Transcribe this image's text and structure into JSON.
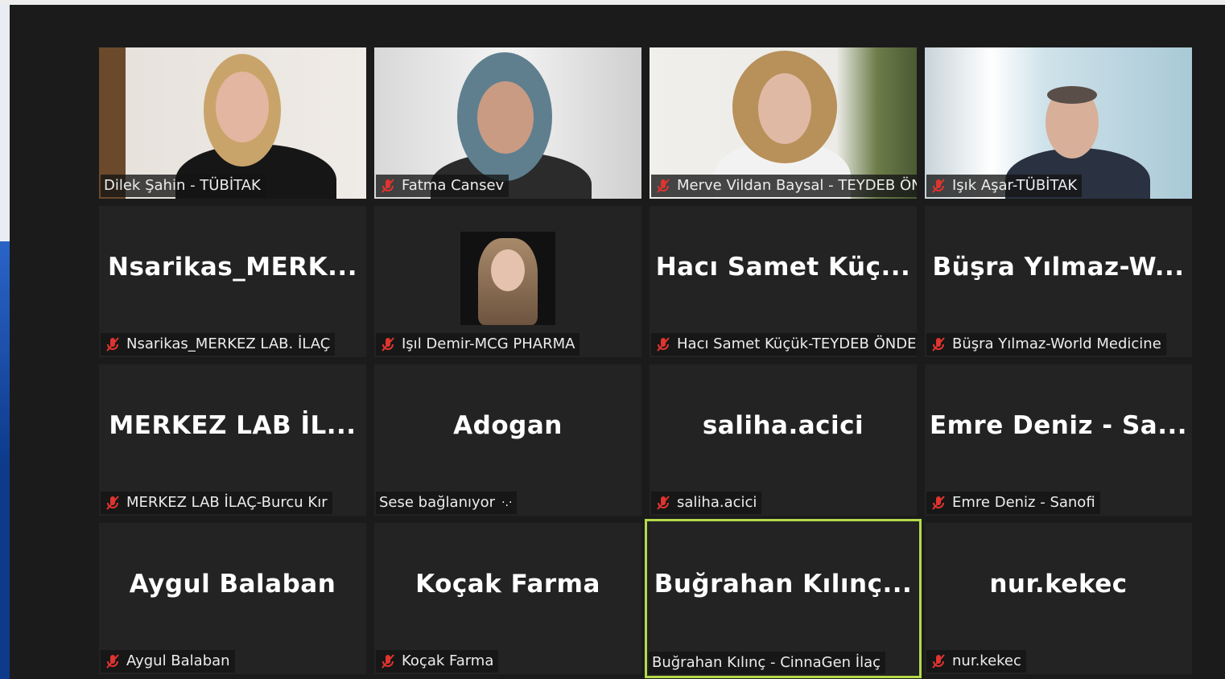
{
  "participants": [
    {
      "display_name": "",
      "label": "Dilek Şahin - TÜBİTAK",
      "muted": false,
      "video": true
    },
    {
      "display_name": "",
      "label": "Fatma Cansev",
      "muted": true,
      "video": true
    },
    {
      "display_name": "",
      "label": "Merve Vildan Baysal - TEYDEB ÖN...",
      "muted": true,
      "video": true
    },
    {
      "display_name": "",
      "label": "Işık Aşar-TÜBİTAK",
      "muted": true,
      "video": true
    },
    {
      "display_name": "Nsarikas_MERK...",
      "label": "Nsarikas_MERKEZ LAB. İLAÇ",
      "muted": true,
      "video": false
    },
    {
      "display_name": "",
      "label": "Işıl Demir-MCG PHARMA",
      "muted": true,
      "video": false
    },
    {
      "display_name": "Hacı Samet Küç...",
      "label": "Hacı Samet Küçük-TEYDEB ÖNDEG",
      "muted": true,
      "video": false
    },
    {
      "display_name": "Büşra Yılmaz-W...",
      "label": "Büşra Yılmaz-World Medicine",
      "muted": true,
      "video": false
    },
    {
      "display_name": "MERKEZ LAB İL...",
      "label": "MERKEZ LAB İLAÇ-Burcu Kır",
      "muted": true,
      "video": false
    },
    {
      "display_name": "Adogan",
      "label": "Sese bağlanıyor",
      "muted": false,
      "video": false
    },
    {
      "display_name": "saliha.acici",
      "label": "saliha.acici",
      "muted": true,
      "video": false
    },
    {
      "display_name": "Emre Deniz - Sa...",
      "label": "Emre Deniz - Sanofi",
      "muted": true,
      "video": false
    },
    {
      "display_name": "Aygul Balaban",
      "label": "Aygul Balaban",
      "muted": true,
      "video": false
    },
    {
      "display_name": "Koçak Farma",
      "label": "Koçak Farma",
      "muted": true,
      "video": false
    },
    {
      "display_name": "Buğrahan Kılınç...",
      "label": "Buğrahan Kılınç - CinnaGen İlaç",
      "muted": false,
      "video": false,
      "active_speaker": true
    },
    {
      "display_name": "nur.kekec",
      "label": "nur.kekec",
      "muted": true,
      "video": false
    }
  ],
  "connecting_indicator": "·.·",
  "colors": {
    "tile_background": "#232323",
    "window_background": "#1b1b1b",
    "active_speaker_border": "#b5d94a",
    "muted_icon": "#e0342f"
  }
}
